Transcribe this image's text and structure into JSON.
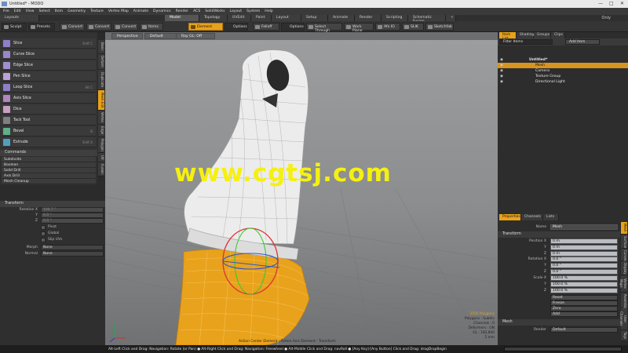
{
  "window": {
    "title": "Untitled* - MODO",
    "controls": [
      "—",
      "□",
      "✕"
    ]
  },
  "menu": [
    "File",
    "Edit",
    "View",
    "Select",
    "Item",
    "Geometry",
    "Texture",
    "Vertex Map",
    "Animate",
    "Dynamics",
    "Render",
    "ACS",
    "SolidWorks",
    "Layout",
    "System",
    "Help"
  ],
  "layout_tabs": {
    "layouts_label": "Layouts",
    "tabs": [
      "Model",
      "Topology",
      "UVEdit",
      "Paint",
      "Layout",
      "Setup",
      "Animate",
      "Render",
      "Scripting",
      "Schematic Fusion"
    ],
    "active": "Model",
    "add": "+",
    "only": "Only"
  },
  "toolbar": {
    "sculpt": "Sculpt",
    "presets": "Presets",
    "convert1": "Convert",
    "convert2": "Convert",
    "convert3": "Convert",
    "items": "Items",
    "element": "Element",
    "options1": "Options",
    "falloff": "Falloff",
    "options2": "Options",
    "select_through": "Select Through",
    "work_plane": "Work Plane",
    "afx_io": "Afx IO",
    "slik": "SLIK",
    "sketchfab": "Sketchfab"
  },
  "tools": [
    {
      "label": "Slice",
      "key": "Shift C",
      "color": "#8f7fc8"
    },
    {
      "label": "Curve Slice",
      "key": "",
      "color": "#9a86c9"
    },
    {
      "label": "Edge Slice",
      "key": "",
      "color": "#a08fcb"
    },
    {
      "label": "Pen Slice",
      "key": "",
      "color": "#b9a2d6"
    },
    {
      "label": "Loop Slice",
      "key": "Alt C",
      "color": "#8f7fc8"
    },
    {
      "label": "Axis Slice",
      "key": "",
      "color": "#b087c0"
    },
    {
      "label": "Dice",
      "key": "",
      "color": "#c8a0c0"
    },
    {
      "label": "Tack Tool",
      "key": "",
      "color": "#7f7f7f"
    },
    {
      "label": "Bevel",
      "key": "B",
      "color": "#5fb08a"
    },
    {
      "label": "Extrude",
      "key": "Shift X",
      "color": "#4fa0c0"
    }
  ],
  "toolbox_tabs": [
    "Basic",
    "Deform",
    "Duplicate",
    "Mesh Edit",
    "Vertex",
    "Edge",
    "Polygon",
    "UV",
    "Fusion"
  ],
  "toolbox_active_tab": "Mesh Edit",
  "commands": {
    "title": "Commands",
    "items": [
      "Subdivide",
      "Boolean",
      "Solid Drill",
      "Axis Drill",
      "Mesh Cleanup"
    ]
  },
  "transform": {
    "title": "Transform",
    "rotation_label": "Rotation X",
    "rotation": [
      "106.7 °",
      "0.0 °",
      "0.0 °"
    ],
    "axis_labels": [
      "Y",
      "Z"
    ],
    "pivot": "Pivot",
    "global": "Global",
    "slip_uvs": "Slip UVs",
    "morph_label": "Morph",
    "morph_value": "None",
    "normal_label": "Normal",
    "normal_value": "None"
  },
  "viewport": {
    "perspective": "Perspective",
    "default": "Default",
    "ray_gl": "Ray GL: Off",
    "watermark": "www.cgtsj.com",
    "info": {
      "polygons": "2556 Polygons",
      "poly_mode": "Polygons : Subdiv",
      "channels": "Channels : 0",
      "deformers": "Deformers : ON",
      "gl": "GL : 182,800",
      "scale": "5 mm"
    },
    "status": "Action Center Element : Action Axis Element : Transform"
  },
  "items_panel": {
    "tabs": [
      "Item List",
      "Shading",
      "Groups",
      "Clips"
    ],
    "active_tab": "Item List",
    "filter": "Filter Items",
    "add_item": "Add Item",
    "rows": [
      {
        "label": "Untitled*",
        "indent": 0,
        "selected": false
      },
      {
        "label": "Mesh",
        "indent": 1,
        "selected": true
      },
      {
        "label": "Camera",
        "indent": 1,
        "selected": false
      },
      {
        "label": "Texture Group",
        "indent": 1,
        "selected": false
      },
      {
        "label": "Directional Light",
        "indent": 1,
        "selected": false
      }
    ]
  },
  "properties": {
    "tabs": [
      "Properties",
      "Channels",
      "Lists"
    ],
    "active_tab": "Properties",
    "name_label": "Name",
    "name_value": "Mesh",
    "transform_title": "Transform",
    "position_label": "Position X",
    "position": [
      "0 m",
      "0 m",
      "0 m"
    ],
    "rotation_label": "Rotation X",
    "rotation": [
      "0.0 °",
      "0.0 °",
      "0.0 °"
    ],
    "scale_label": "Scale X",
    "scale": [
      "100.0 %",
      "100.0 %",
      "100.0 %"
    ],
    "axis_y": "Y",
    "axis_z": "Z",
    "buttons": [
      "Reset",
      "Freeze",
      "Zero",
      "Add"
    ],
    "mesh_title": "Mesh",
    "render_label": "Render",
    "render_value": "Default",
    "vtabs": [
      "Mesh",
      "Surface",
      "Curves",
      "Display",
      "Vertex Maps",
      "Assembly",
      "User Channels",
      "Tags"
    ]
  },
  "statusbar": "Alt-Left Click and Drag: Navigation: Rotate (or Pan) ● Alt-Right Click and Drag: Navigation: Freewheel ● Alt-Middle Click and Drag: navRoll ● [Any Key]-[Any Button] Click and Drag: dragDropBegin"
}
